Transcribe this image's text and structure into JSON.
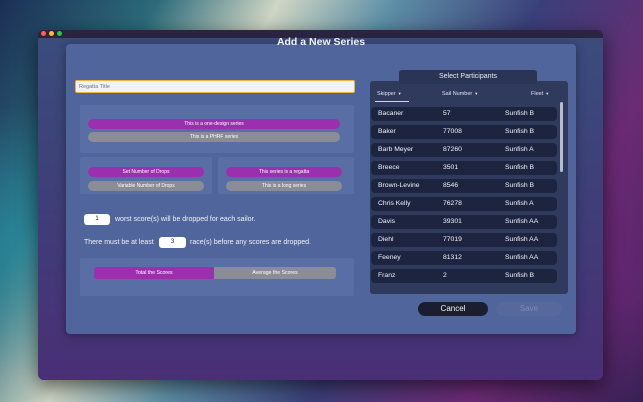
{
  "dialog": {
    "title": "Add a New Series",
    "regatta_title_placeholder": "Regatta Title"
  },
  "series_type": {
    "one_design": "This is a one-design series",
    "phrf": "This is a PHRF series",
    "selected": "one_design"
  },
  "drops": {
    "set_number": "Set Number of Drops",
    "variable_number": "Variable Number of Drops",
    "selected": "set_number"
  },
  "series_kind": {
    "regatta": "This series is a regatta",
    "long_series": "This is a long series",
    "selected": "regatta"
  },
  "drop_rule": {
    "worst_count": "1",
    "worst_text": "worst score(s) will be dropped for each sailor.",
    "min_prefix": "There must be at least",
    "min_races": "3",
    "min_suffix": "race(s) before any scores are dropped."
  },
  "scoring": {
    "total": "Total the Scores",
    "average": "Average the Scores",
    "selected": "total"
  },
  "participants": {
    "tab_label": "Select Participants",
    "columns": {
      "skipper": "Skipper",
      "sail_number": "Sail Number",
      "fleet": "Fleet"
    },
    "rows": [
      {
        "skipper": "Bacaner",
        "sail": "57",
        "fleet": "Sunfish B"
      },
      {
        "skipper": "Baker",
        "sail": "77008",
        "fleet": "Sunfish B"
      },
      {
        "skipper": "Barb Meyer",
        "sail": "87260",
        "fleet": "Sunfish A"
      },
      {
        "skipper": "Breece",
        "sail": "3501",
        "fleet": "Sunfish B"
      },
      {
        "skipper": "Brown-Levine",
        "sail": "8546",
        "fleet": "Sunfish B"
      },
      {
        "skipper": "Chris Kelly",
        "sail": "76278",
        "fleet": "Sunfish A"
      },
      {
        "skipper": "Davis",
        "sail": "39301",
        "fleet": "Sunfish AA"
      },
      {
        "skipper": "Diehl",
        "sail": "77019",
        "fleet": "Sunfish AA"
      },
      {
        "skipper": "Feeney",
        "sail": "81312",
        "fleet": "Sunfish AA"
      },
      {
        "skipper": "Franz",
        "sail": "2",
        "fleet": "Sunfish B"
      }
    ]
  },
  "buttons": {
    "cancel": "Cancel",
    "save": "Save"
  },
  "colors": {
    "accent_purple": "#9b2fae",
    "input_focus": "#f2b23a",
    "row_bg": "#1c2440"
  }
}
